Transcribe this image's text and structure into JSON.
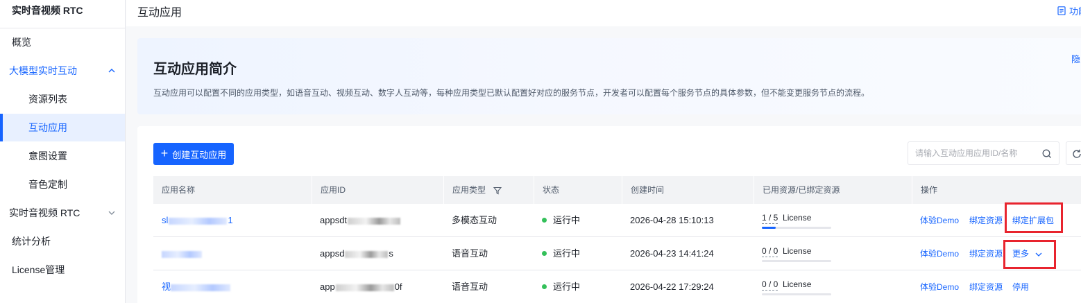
{
  "sidebar": {
    "title": "实时音视频 RTC",
    "items": [
      {
        "label": "概览"
      },
      {
        "label": "大模型实时互动"
      },
      {
        "label": "资源列表"
      },
      {
        "label": "互动应用"
      },
      {
        "label": "意图设置"
      },
      {
        "label": "音色定制"
      },
      {
        "label": "实时音视频 RTC"
      },
      {
        "label": "统计分析"
      },
      {
        "label": "License管理"
      }
    ]
  },
  "header": {
    "title": "互动应用",
    "doc_link": "功能"
  },
  "intro": {
    "title": "互动应用简介",
    "description": "互动应用可以配置不同的应用类型，如语音互动、视频互动、数字人互动等，每种应用类型已默认配置好对应的服务节点，开发者可以配置每个服务节点的具体参数，但不能变更服务节点的流程。",
    "hide": "隐"
  },
  "toolbar": {
    "create_label": "创建互动应用",
    "search_placeholder": "请输入互动应用应用ID/名称"
  },
  "table": {
    "columns": [
      "应用名称",
      "应用ID",
      "应用类型",
      "状态",
      "创建时间",
      "已用资源/已绑定资源",
      "操作"
    ],
    "rows": [
      {
        "name_prefix": "sl",
        "name_suffix": "1",
        "id_prefix": "appsdt",
        "id_suffix": "",
        "type": "多模态互动",
        "status": "运行中",
        "created": "2026-04-28 15:10:13",
        "usage_count": "1 / 5",
        "usage_unit": "License",
        "usage_fraction": 0.2,
        "ops": [
          "体验Demo",
          "绑定资源",
          "绑定扩展包"
        ]
      },
      {
        "name_prefix": "",
        "name_suffix": "",
        "id_prefix": "appsd",
        "id_suffix": "s",
        "type": "语音互动",
        "status": "运行中",
        "created": "2026-04-23 14:41:24",
        "usage_count": "0 / 0",
        "usage_unit": "License",
        "usage_fraction": 0,
        "ops": [
          "体验Demo",
          "绑定资源",
          "更多"
        ]
      },
      {
        "name_prefix": "视",
        "name_suffix": "",
        "id_prefix": "app",
        "id_suffix": "0f",
        "type": "语音互动",
        "status": "运行中",
        "created": "2026-04-22 17:29:24",
        "usage_count": "0 / 0",
        "usage_unit": "License",
        "usage_fraction": 0,
        "ops": [
          "体验Demo",
          "绑定资源",
          "停用"
        ]
      }
    ]
  },
  "colors": {
    "primary": "#1664ff",
    "running": "#34c05a",
    "highlight": "#e8242e"
  }
}
